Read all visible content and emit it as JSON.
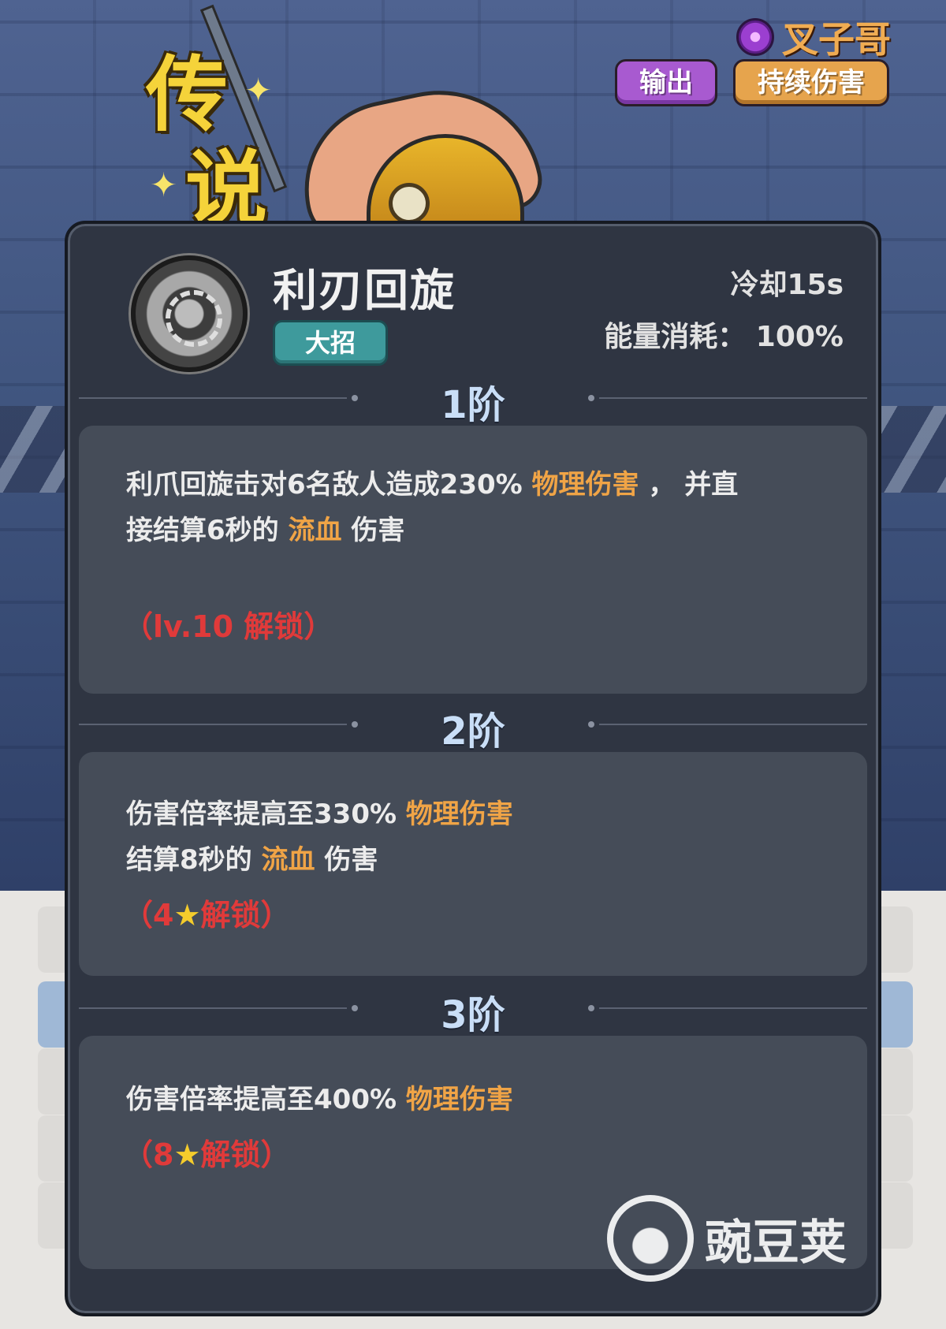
{
  "hero": {
    "rarity_label_1": "传",
    "rarity_label_2": "说",
    "name": "叉子哥",
    "tags": [
      "输出",
      "持续伤害"
    ]
  },
  "skill": {
    "name": "利刃回旋",
    "type": "大招",
    "cooldown": "冷却15s",
    "energy": "能量消耗：  100%"
  },
  "stages": [
    {
      "title": "1阶",
      "line1_a": "利爪回旋击对6名敌人造成230%",
      "line1_hl": "物理伤害",
      "line1_b": "，  并直",
      "line2_a": "接结算6秒的",
      "line2_hl": "流血",
      "line2_b": "伤害",
      "unlock": "（lv.10 解锁）"
    },
    {
      "title": "2阶",
      "line1_a": "伤害倍率提高至330%",
      "line1_hl": "物理伤害",
      "line2_a": "结算8秒的",
      "line2_hl": "流血",
      "line2_b": "伤害",
      "unlock_a": "（4",
      "unlock_b": "解锁）"
    },
    {
      "title": "3阶",
      "line1_a": "伤害倍率提高至400%",
      "line1_hl": "物理伤害",
      "unlock_a": "（8",
      "unlock_b": "解锁）"
    }
  ],
  "watermark": {
    "text": "豌豆荚"
  },
  "colors": {
    "highlight": "#f0a446",
    "unlock_red": "#e03a3a",
    "stage_title": "#c9def7",
    "panel_bg": "#2f3542"
  }
}
